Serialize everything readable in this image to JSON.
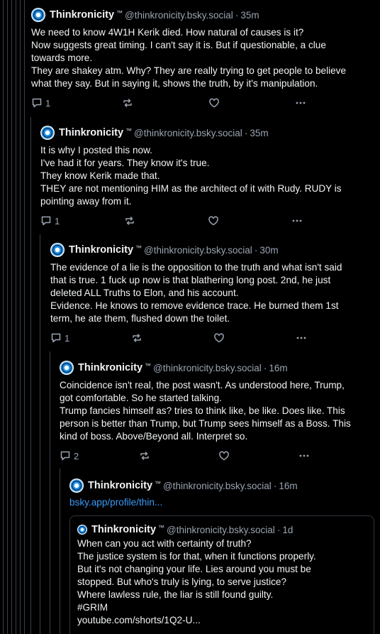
{
  "author": {
    "display_name": "Thinkronicity",
    "name_mark": "™",
    "handle": "@thinkronicity.bsky.social",
    "separator": "·"
  },
  "icons": {
    "reply": "reply-bubble-icon",
    "repost": "repost-icon",
    "like": "heart-icon",
    "more": "more-dots-icon"
  },
  "colors": {
    "background": "#000000",
    "text": "#f1f3f5",
    "muted": "#9aa4b2",
    "link": "#3b9af6",
    "thread_line": "#3a3f46"
  },
  "posts": [
    {
      "time": "35m",
      "lines": [
        "We need to know 4W1H Kerik died. How natural of causes is it?",
        "Now suggests great timing. I can't say it is. But if questionable, a clue",
        "towards more.",
        "They are shakey atm. Why? They are really trying to get people to believe",
        "what they say. But in saying it, shows the truth, by it's manipulation."
      ],
      "reply_count": "1"
    },
    {
      "time": "35m",
      "lines": [
        "It is why I posted this now.",
        "I've had it for years. They know it's true.",
        "They know Kerik made that.",
        "THEY are not mentioning HIM as the architect of it with Rudy. RUDY is",
        "pointing away from it."
      ],
      "reply_count": "1"
    },
    {
      "time": "30m",
      "lines": [
        "The evidence of a lie is the opposition to the truth and what isn't said",
        "that is true. 1 fuck up now is that blathering long post. 2nd, he just",
        "deleted ALL Truths to Elon, and his account.",
        "Evidence. He knows to remove evidence trace. He burned them 1st",
        "term, he ate them, flushed down the toilet."
      ],
      "reply_count": "1"
    },
    {
      "time": "16m",
      "lines": [
        "Coincidence isn't real, the post wasn't. As understood here, Trump,",
        "got comfortable. So he started talking.",
        "Trump fancies himself as? tries to think like, be like. Does like. This",
        "person is better than Trump, but Trump sees himself as a Boss. This",
        "kind of boss. Above/Beyond all. Interpret so."
      ],
      "reply_count": "2"
    },
    {
      "time": "16m",
      "link": "bsky.app/profile/thin..."
    }
  ],
  "quote": {
    "time": "1d",
    "lines": [
      "When can you act with certainty of truth?",
      "The justice system is for that, when it functions properly.",
      "But it's not changing your life. Lies around you must be",
      "stopped. But who's truly is lying, to serve justice?",
      "Where lawless rule, the liar is still found guilty.",
      "#GRIM",
      "youtube.com/shorts/1Q2-U..."
    ]
  }
}
